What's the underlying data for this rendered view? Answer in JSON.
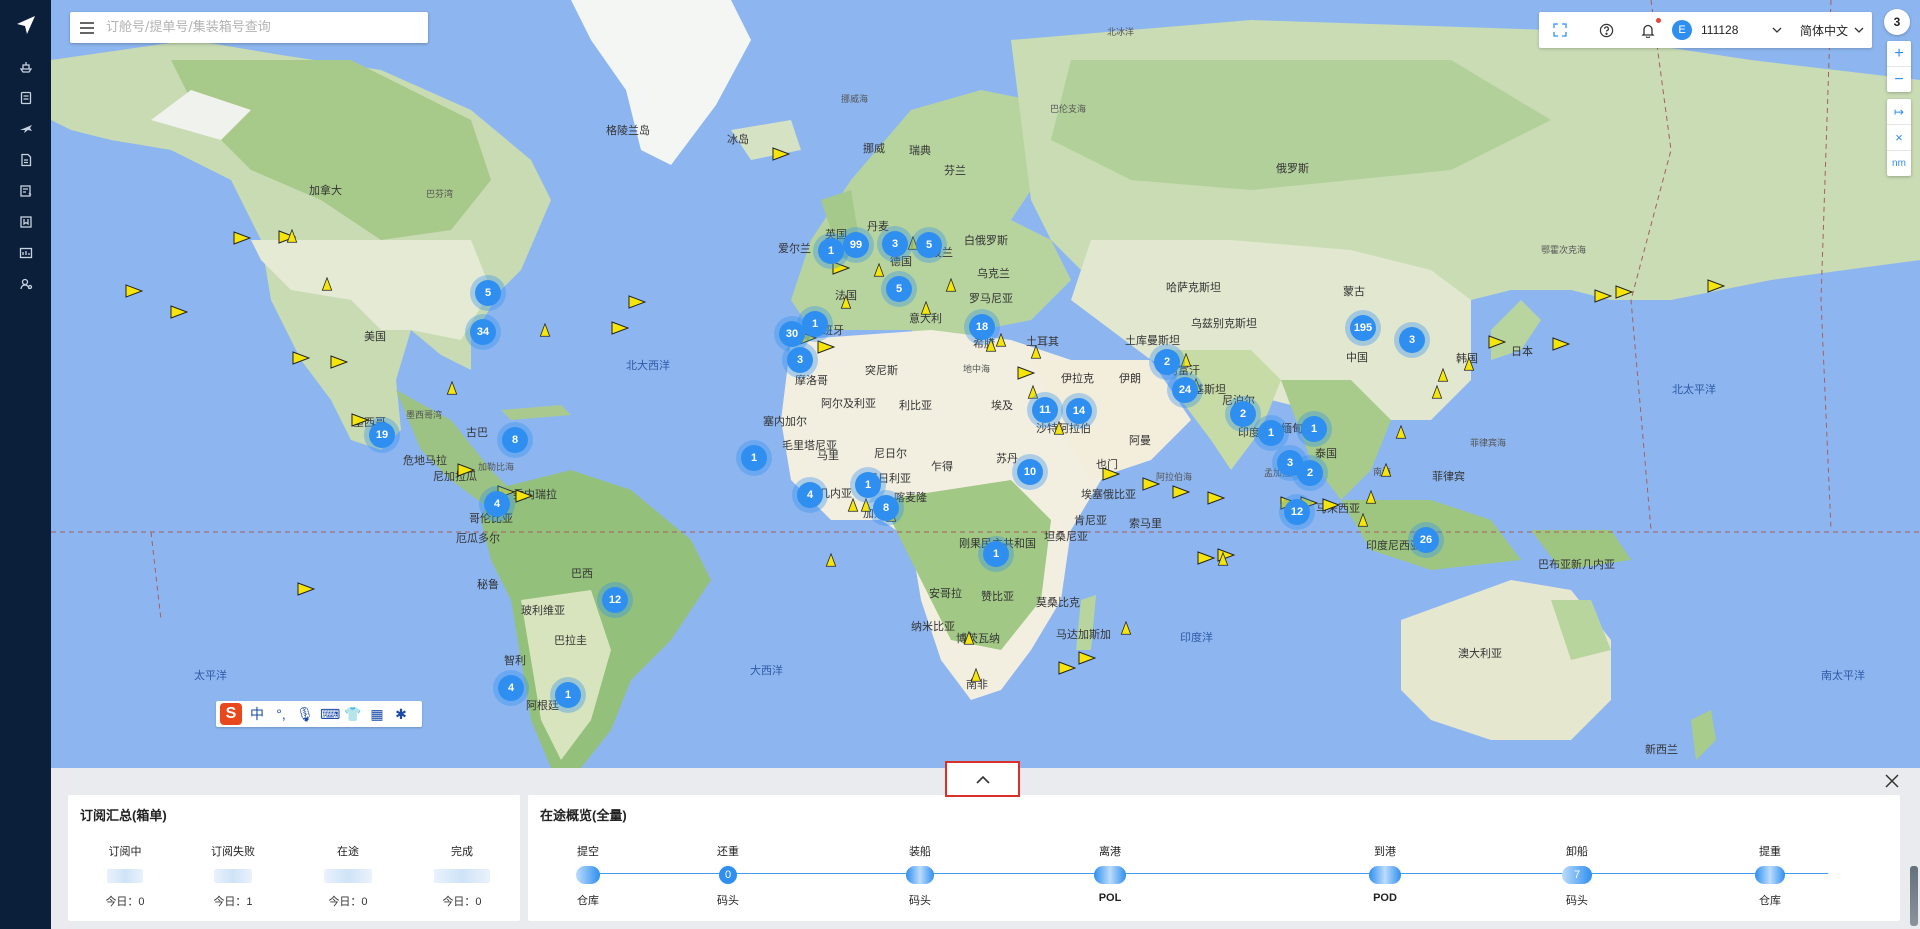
{
  "search": {
    "placeholder": "订舱号/提单号/集装箱号查询"
  },
  "toolbar": {
    "user_initial": "E",
    "user_id": "111128",
    "language": "简体中文"
  },
  "corner_count": "3",
  "zoom": {
    "plus": "+",
    "minus": "−"
  },
  "tools": {
    "measure": "↦",
    "clear": "×",
    "unit": "nm"
  },
  "sidebar": {
    "items": [
      {
        "icon": "ship-icon"
      },
      {
        "icon": "document-icon"
      },
      {
        "icon": "plane-icon"
      },
      {
        "icon": "file-icon"
      },
      {
        "icon": "edit-list-icon"
      },
      {
        "icon": "bookmark-icon"
      },
      {
        "icon": "dashboard-icon"
      },
      {
        "icon": "settings-user-icon"
      }
    ]
  },
  "map": {
    "labels": [
      "格陵兰岛",
      "加拿大",
      "美国",
      "墨西哥",
      "古巴",
      "危地马拉",
      "尼加拉瓜",
      "委内瑞拉",
      "哥伦比亚",
      "厄瓜多尔",
      "秘鲁",
      "巴西",
      "玻利维亚",
      "巴拉圭",
      "智利",
      "阿根廷",
      "冰岛",
      "挪威",
      "瑞典",
      "芬兰",
      "英国",
      "爱尔兰",
      "丹麦",
      "德国",
      "法国",
      "西班牙",
      "意大利",
      "波兰",
      "白俄罗斯",
      "乌克兰",
      "罗马尼亚",
      "希腊",
      "土耳其",
      "俄罗斯",
      "摩洛哥",
      "阿尔及利亚",
      "利比亚",
      "埃及",
      "突尼斯",
      "毛里塔尼亚",
      "马里",
      "尼日尔",
      "乍得",
      "苏丹",
      "尼日利亚",
      "喀麦隆",
      "刚果民主共和国",
      "安哥拉",
      "赞比亚",
      "纳米比亚",
      "博茨瓦纳",
      "南非",
      "莫桑比克",
      "马达加斯加",
      "坦桑尼亚",
      "肯尼亚",
      "埃塞俄比亚",
      "索马里",
      "加蓬",
      "几内亚",
      "塞内加尔",
      "沙特阿拉伯",
      "伊拉克",
      "伊朗",
      "阿富汗",
      "巴基斯坦",
      "印度",
      "阿曼",
      "也门",
      "哈萨克斯坦",
      "土库曼斯坦",
      "乌兹别克斯坦",
      "蒙古",
      "中国",
      "尼泊尔",
      "缅甸",
      "泰国",
      "马来西亚",
      "印度尼西亚",
      "菲律宾",
      "日本",
      "韩国",
      "澳大利亚",
      "巴布亚新几内亚",
      "新西兰"
    ],
    "oceans": [
      "北大西洋",
      "太平洋",
      "北太平洋",
      "大西洋",
      "印度洋",
      "南太平洋",
      "墨西哥湾",
      "加勒比海",
      "巴芬湾",
      "挪威海",
      "北冰洋",
      "阿拉伯海",
      "孟加拉湾",
      "南海",
      "菲律宾海",
      "鄂霍次克海",
      "巴伦支海",
      "地中海"
    ],
    "clusters": [
      "99",
      "1",
      "3",
      "5",
      "5",
      "1",
      "30",
      "3",
      "18",
      "195",
      "3",
      "2",
      "24",
      "11",
      "14",
      "10",
      "2",
      "1",
      "1",
      "3",
      "2",
      "12",
      "26",
      "1",
      "4",
      "1",
      "8",
      "1",
      "12",
      "4",
      "1",
      "34",
      "5",
      "19",
      "8",
      "4"
    ]
  },
  "ime": {
    "logo": "S",
    "lang": "中",
    "punct": "°,",
    "mic": "🎙",
    "kbd": "⌨",
    "skin": "👕",
    "apps": "▦",
    "gear": "✱"
  },
  "panel": {
    "subscription": {
      "title": "订阅汇总(箱单)",
      "cols": [
        {
          "label": "订阅中",
          "today": "今日：0"
        },
        {
          "label": "订阅失败",
          "today": "今日：1"
        },
        {
          "label": "在途",
          "today": "今日：0"
        },
        {
          "label": "完成",
          "today": "今日：0"
        }
      ]
    },
    "transit": {
      "title": "在途概览(全量)",
      "stages": [
        {
          "top": "提空",
          "bottom": "仓库",
          "value": ""
        },
        {
          "top": "还重",
          "bottom": "码头",
          "value": "0"
        },
        {
          "top": "装船",
          "bottom": "码头",
          "value": ""
        },
        {
          "top": "离港",
          "bottom": "POL",
          "value": ""
        },
        {
          "top": "到港",
          "bottom": "POD",
          "value": ""
        },
        {
          "top": "卸船",
          "bottom": "码头",
          "value": "7"
        },
        {
          "top": "提重",
          "bottom": "仓库",
          "value": ""
        }
      ]
    }
  }
}
